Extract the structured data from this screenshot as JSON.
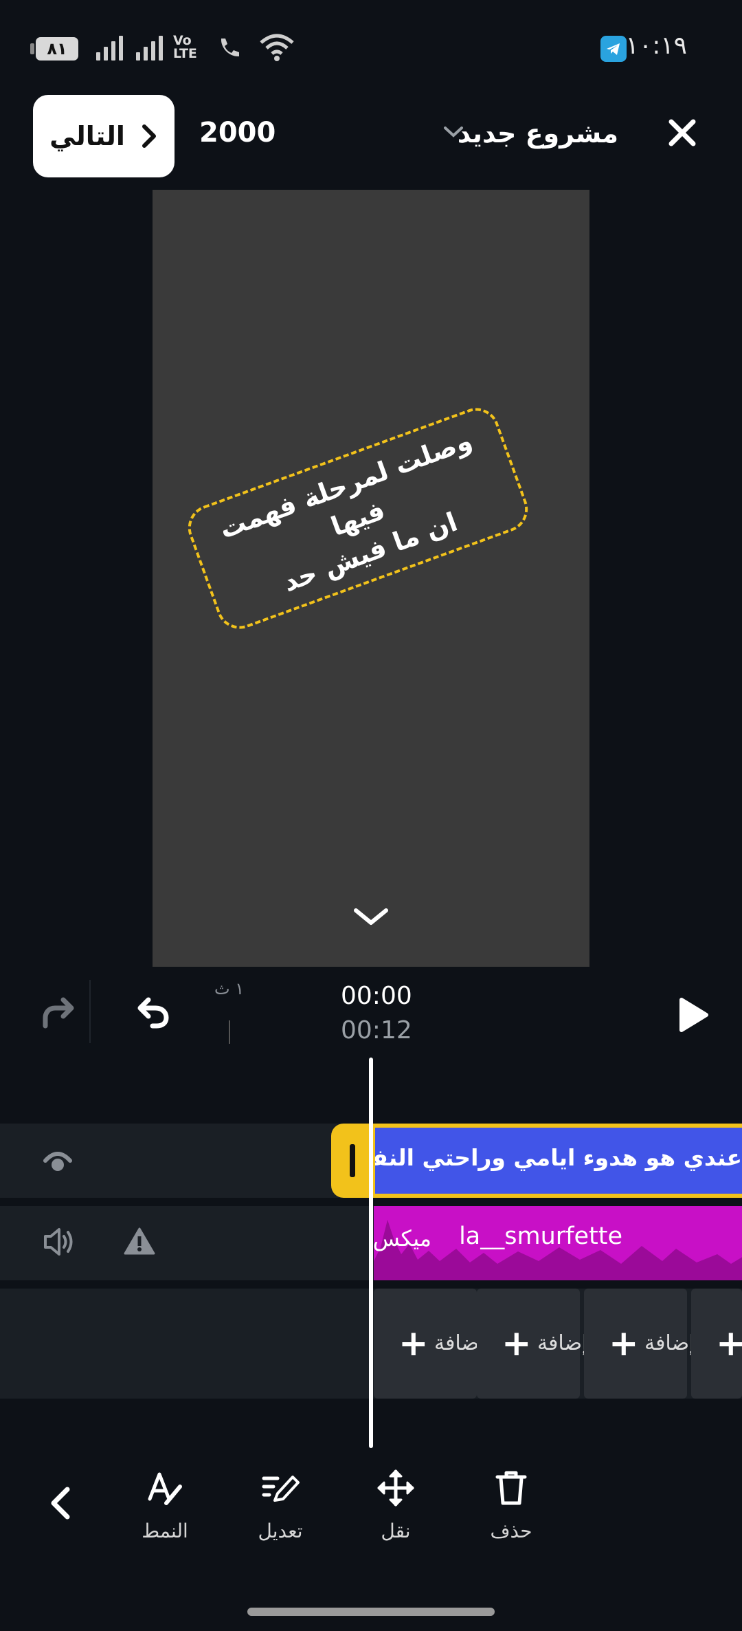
{
  "status_bar": {
    "time": "١٠:١٩",
    "battery": "٨١",
    "lte_label_top": "Vo",
    "lte_label_bottom": "LTE"
  },
  "header": {
    "next_label": "التالي",
    "resolution": "2000",
    "project_title": "مشروع جديد"
  },
  "preview": {
    "caption_text": "وصلت لمرحلة فهمت فيها\nان ما فيش حد"
  },
  "transport": {
    "frame_label": "١ ث",
    "current_time": "00:00",
    "total_time": "00:12"
  },
  "timeline": {
    "text_clip": "عندي هو هدوء ايامي وراحتي النفسية",
    "audio_artist": "la__smurfette",
    "audio_name": "ميكس",
    "add_placeholder": "إضافة"
  },
  "toolbar": {
    "style_label": "النمط",
    "edit_label": "تعديل",
    "move_label": "نقل",
    "delete_label": "حذف"
  },
  "colors": {
    "accent_yellow": "#f2c21b",
    "text_clip_blue": "#4155e8",
    "audio_clip_magenta": "#c810c6",
    "background": "#0d1117"
  },
  "icons": [
    "close-icon",
    "chevron-down-icon",
    "chevron-right-icon",
    "redo-icon",
    "undo-icon",
    "play-icon",
    "visibility-icon",
    "volume-icon",
    "warning-icon",
    "style-icon",
    "edit-icon",
    "move-icon",
    "trash-icon",
    "back-icon"
  ]
}
